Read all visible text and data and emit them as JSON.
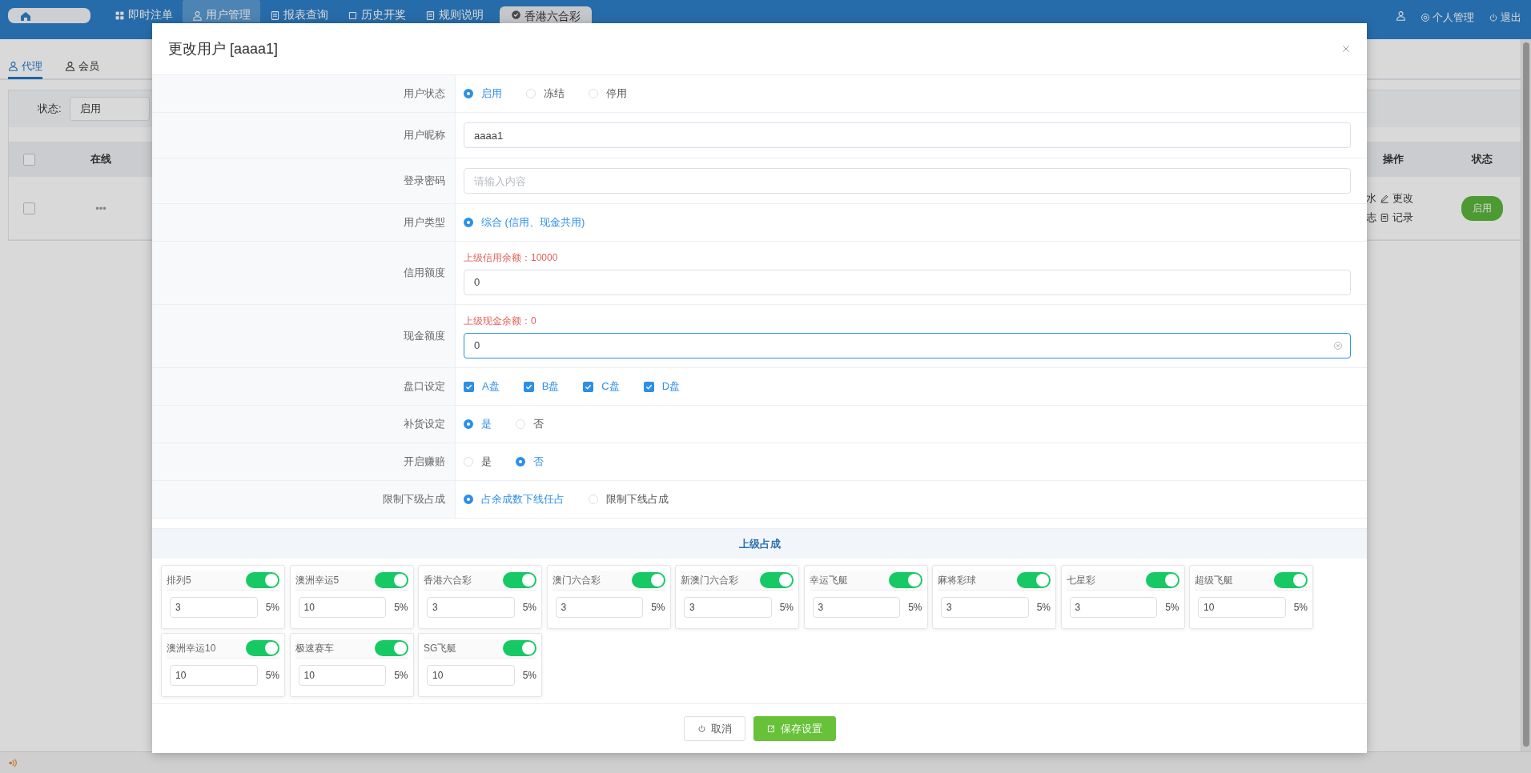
{
  "top_bar": {
    "nav": [
      {
        "label": "即时注单",
        "selected": false
      },
      {
        "label": "用户管理",
        "selected": true
      },
      {
        "label": "报表查询",
        "selected": false
      },
      {
        "label": "历史开奖",
        "selected": false
      },
      {
        "label": "规则说明",
        "selected": false
      }
    ],
    "lottery_tab": {
      "label": "香港六合彩"
    },
    "links": [
      {
        "label": "个人管理"
      },
      {
        "label": "退出"
      }
    ]
  },
  "background": {
    "tabs": [
      {
        "label": "代理",
        "selected": true
      },
      {
        "label": "会员",
        "selected": false
      }
    ],
    "filter": {
      "label": "状态:",
      "value": "启用"
    },
    "table": {
      "select_all": {
        "checked": false
      },
      "columns": [
        "在线",
        "操作",
        "状态"
      ],
      "row": {
        "checked": false,
        "online": "•••",
        "actions": [
          {
            "cut": "水",
            "label": "更改"
          },
          {
            "cut": "志",
            "label": "记录"
          }
        ],
        "status": "启用"
      }
    }
  },
  "dialog": {
    "title": "更改用户 [aaaa1]",
    "form": [
      {
        "kind": "radio",
        "label": "用户状态",
        "options": [
          {
            "label": "启用",
            "selected": true
          },
          {
            "label": "冻结",
            "selected": false
          },
          {
            "label": "停用",
            "selected": false
          }
        ]
      },
      {
        "kind": "input",
        "label": "用户昵称",
        "value": "aaaa1"
      },
      {
        "kind": "input",
        "label": "登录密码",
        "placeholder": "请输入内容"
      },
      {
        "kind": "radio",
        "label": "用户类型",
        "options": [
          {
            "label": "综合 (信用、现金共用)",
            "selected": true
          }
        ]
      },
      {
        "kind": "input",
        "label": "信用额度",
        "hint": "上级信用余额：10000",
        "value": "0"
      },
      {
        "kind": "input",
        "label": "现金额度",
        "hint": "上级现金余额：0",
        "value": "0",
        "focused": true
      },
      {
        "kind": "checkbox",
        "label": "盘口设定",
        "options": [
          {
            "label": "A盘",
            "checked": true
          },
          {
            "label": "B盘",
            "checked": true
          },
          {
            "label": "C盘",
            "checked": true
          },
          {
            "label": "D盘",
            "checked": true
          }
        ]
      },
      {
        "kind": "radio",
        "label": "补货设定",
        "options": [
          {
            "label": "是",
            "selected": true
          },
          {
            "label": "否",
            "selected": false
          }
        ]
      },
      {
        "kind": "radio",
        "label": "开启赚赔",
        "options": [
          {
            "label": "是",
            "selected": false
          },
          {
            "label": "否",
            "selected": true
          }
        ]
      },
      {
        "kind": "radio",
        "label": "限制下级占成",
        "options": [
          {
            "label": "占余成数下线任占",
            "selected": true
          },
          {
            "label": "限制下线占成",
            "selected": false
          }
        ]
      }
    ],
    "shares": {
      "title": "上级占成",
      "items": [
        {
          "name": "排列5",
          "on": true,
          "value": "3",
          "percent": "5%"
        },
        {
          "name": "澳洲幸运5",
          "on": true,
          "value": "10",
          "percent": "5%"
        },
        {
          "name": "香港六合彩",
          "on": true,
          "value": "3",
          "percent": "5%"
        },
        {
          "name": "澳门六合彩",
          "on": true,
          "value": "3",
          "percent": "5%"
        },
        {
          "name": "新澳门六合彩",
          "on": true,
          "value": "3",
          "percent": "5%"
        },
        {
          "name": "幸运飞艇",
          "on": true,
          "value": "3",
          "percent": "5%"
        },
        {
          "name": "麻将彩球",
          "on": true,
          "value": "3",
          "percent": "5%"
        },
        {
          "name": "七星彩",
          "on": true,
          "value": "3",
          "percent": "5%"
        },
        {
          "name": "超级飞艇",
          "on": true,
          "value": "10",
          "percent": "5%"
        },
        {
          "name": "澳洲幸运10",
          "on": true,
          "value": "10",
          "percent": "5%"
        },
        {
          "name": "极速赛车",
          "on": true,
          "value": "10",
          "percent": "5%"
        },
        {
          "name": "SG飞艇",
          "on": true,
          "value": "10",
          "percent": "5%"
        }
      ]
    },
    "buttons": [
      {
        "label": "取消",
        "kind": "default"
      },
      {
        "label": "保存设置",
        "kind": "primary"
      }
    ]
  }
}
